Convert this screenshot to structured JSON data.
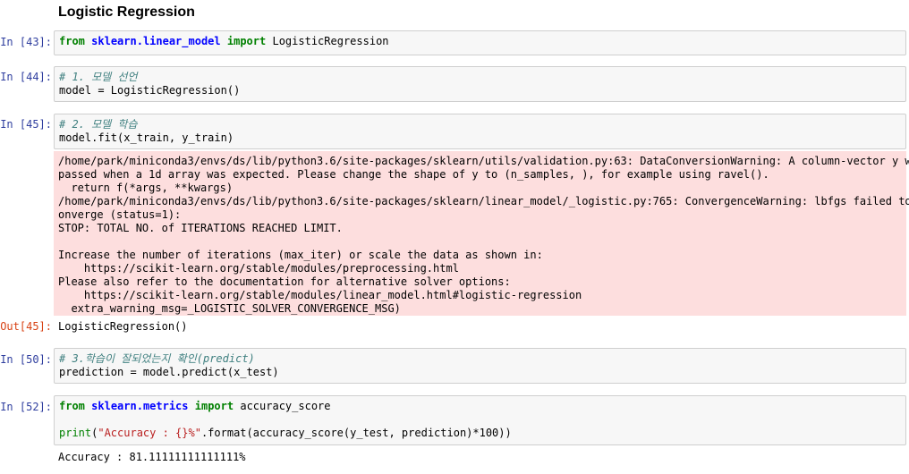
{
  "heading": "Logistic Regression",
  "cells": {
    "c43": {
      "prompt": "In [43]:",
      "kw_from": "from",
      "module": "sklearn.linear_model",
      "kw_import": "import",
      "name": "LogisticRegression"
    },
    "c44": {
      "prompt": "In [44]:",
      "comment": "# 1. 모델 선언",
      "line2": "model = LogisticRegression()"
    },
    "c45": {
      "prompt": "In [45]:",
      "comment": "# 2. 모델 학습",
      "line2": "model.fit(x_train, y_train)",
      "warning": "/home/park/miniconda3/envs/ds/lib/python3.6/site-packages/sklearn/utils/validation.py:63: DataConversionWarning: A column-vector y was\npassed when a 1d array was expected. Please change the shape of y to (n_samples, ), for example using ravel().\n  return f(*args, **kwargs)\n/home/park/miniconda3/envs/ds/lib/python3.6/site-packages/sklearn/linear_model/_logistic.py:765: ConvergenceWarning: lbfgs failed to c\nonverge (status=1):\nSTOP: TOTAL NO. of ITERATIONS REACHED LIMIT.\n\nIncrease the number of iterations (max_iter) or scale the data as shown in:\n    https://scikit-learn.org/stable/modules/preprocessing.html\nPlease also refer to the documentation for alternative solver options:\n    https://scikit-learn.org/stable/modules/linear_model.html#logistic-regression\n  extra_warning_msg=_LOGISTIC_SOLVER_CONVERGENCE_MSG)",
      "out_prompt": "Out[45]:",
      "output": "LogisticRegression()"
    },
    "c50": {
      "prompt": "In [50]:",
      "comment": "# 3.학습이 잘되었는지 확인(predict)",
      "line2": "prediction = model.predict(x_test)"
    },
    "c52": {
      "prompt": "In [52]:",
      "kw_from": "from",
      "module": "sklearn.metrics",
      "kw_import": "import",
      "name": "accuracy_score",
      "print_fn": "print",
      "print_open": "(",
      "print_str": "\"Accuracy : {}%\"",
      "print_rest": ".format(accuracy_score(y_test, prediction)*100))",
      "output": "Accuracy : 81.11111111111111%"
    }
  }
}
